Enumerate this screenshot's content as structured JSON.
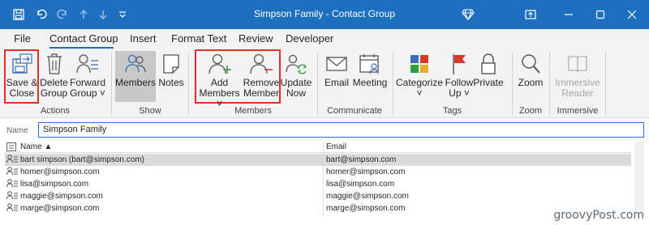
{
  "window": {
    "title": "Simpson Family  -  Contact Group"
  },
  "menu": {
    "tabs": [
      "File",
      "Contact Group",
      "Insert",
      "Format Text",
      "Review",
      "Developer"
    ]
  },
  "ribbon": {
    "actions": {
      "save_close": [
        "Save &",
        "Close"
      ],
      "delete_group": [
        "Delete",
        "Group"
      ],
      "forward_group": [
        "Forward",
        "Group ˅"
      ],
      "label": "Actions"
    },
    "show": {
      "members": "Members",
      "notes": "Notes",
      "label": "Show"
    },
    "members": {
      "add_members": [
        "Add",
        "Members ˅"
      ],
      "remove_member": [
        "Remove",
        "Member"
      ],
      "update_now": [
        "Update",
        "Now"
      ],
      "label": "Members"
    },
    "communicate": {
      "email": "Email",
      "meeting": "Meeting",
      "label": "Communicate"
    },
    "tags": {
      "categorize": [
        "Categorize",
        "˅"
      ],
      "follow_up": [
        "Follow",
        "Up ˅"
      ],
      "private": "Private",
      "label": "Tags"
    },
    "zoom": {
      "zoom": "Zoom",
      "label": "Zoom"
    },
    "immersive": {
      "reader": [
        "Immersive",
        "Reader"
      ],
      "label": "Immersive"
    }
  },
  "form": {
    "name_label": "Name",
    "name_value": "Simpson Family"
  },
  "table": {
    "headers": [
      "Name",
      "Email"
    ],
    "rows": [
      {
        "name": "bart simpson (bart@simpson.com)",
        "email": "bart@simpson.com"
      },
      {
        "name": "homer@simpson.com",
        "email": "homer@simpson.com"
      },
      {
        "name": "lisa@simpson.com",
        "email": "lisa@simpson.com"
      },
      {
        "name": "maggie@simpson.com",
        "email": "maggie@simpson.com"
      },
      {
        "name": "marge@simpson.com",
        "email": "marge@simpson.com"
      }
    ]
  },
  "watermark": "groovyPost.com",
  "colors": {
    "titlebar": "#1e6fc0",
    "highlight": "#e0302a",
    "ribbon_bg": "#f3f3f3"
  }
}
